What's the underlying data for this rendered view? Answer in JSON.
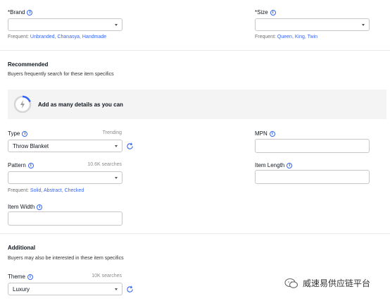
{
  "brand": {
    "label": "*Brand",
    "value": "",
    "frequent_prefix": "Frequent: ",
    "frequent": [
      "Unbranded",
      "Chanasya",
      "Handmade"
    ]
  },
  "size": {
    "label": "*Size",
    "value": "",
    "frequent_prefix": "Frequent: ",
    "frequent": [
      "Queen",
      "King",
      "Twin"
    ]
  },
  "recommended": {
    "title": "Recommended",
    "subtitle": "Buyers frequently search for these item specifics",
    "banner_text": "Add as many details as you can"
  },
  "type": {
    "label": "Type",
    "hint": "Trending",
    "value": "Throw Blanket"
  },
  "mpn": {
    "label": "MPN",
    "value": ""
  },
  "pattern": {
    "label": "Pattern",
    "hint": "10.6K searches",
    "value": "",
    "frequent_prefix": "Frequent: ",
    "frequent": [
      "Solid",
      "Abstract",
      "Checked"
    ]
  },
  "item_length": {
    "label": "Item Length",
    "value": ""
  },
  "item_width": {
    "label": "Item Width",
    "value": ""
  },
  "additional": {
    "title": "Additional",
    "subtitle": "Buyers may also be interested in these item specifics"
  },
  "theme": {
    "label": "Theme",
    "hint": "10K searches",
    "value": "Luxury"
  },
  "watermark": {
    "text": "威速易供应链平台"
  },
  "colors": {
    "accent": "#3665f3",
    "banner_bg": "#f4f4f4",
    "border": "#c7c7c7"
  },
  "icons": {
    "info": "info-icon",
    "dropdown": "chevron-down-icon",
    "refresh": "refresh-icon",
    "progress": "progress-ring-icon",
    "wechat": "wechat-icon"
  }
}
